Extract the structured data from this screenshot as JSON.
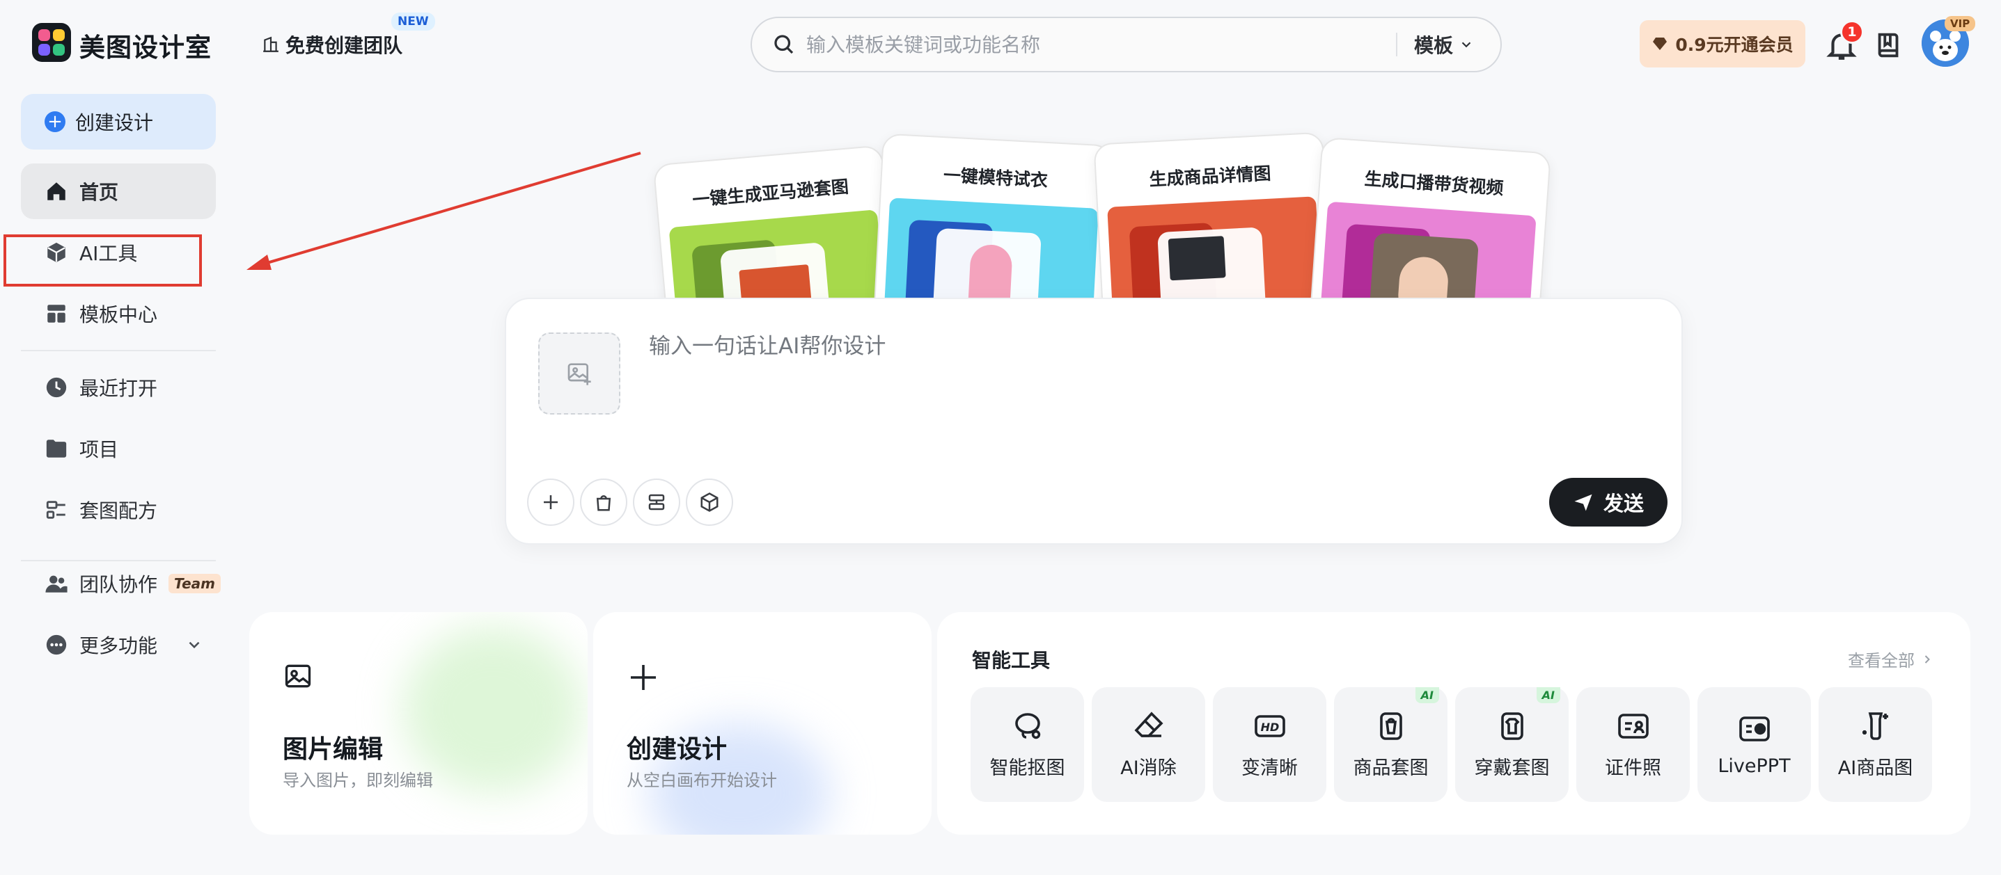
{
  "header": {
    "brand": "美图设计室",
    "team_link": "免费创建团队",
    "new_badge": "NEW",
    "search_placeholder": "输入模板关键词或功能名称",
    "search_type": "模板",
    "vip_button": "0.9元开通会员",
    "notification_count": "1",
    "avatar_badge": "VIP"
  },
  "sidebar": {
    "create": "创建设计",
    "items": [
      {
        "label": "首页",
        "icon": "home-icon",
        "active": true
      },
      {
        "label": "AI工具",
        "icon": "cube-icon",
        "active": false
      },
      {
        "label": "模板中心",
        "icon": "layout-icon",
        "active": false
      },
      {
        "label": "最近打开",
        "icon": "clock-icon",
        "active": false
      },
      {
        "label": "项目",
        "icon": "folder-icon",
        "active": false
      },
      {
        "label": "套图配方",
        "icon": "recipe-icon",
        "active": false
      },
      {
        "label": "团队协作",
        "icon": "team-icon",
        "active": false
      },
      {
        "label": "更多功能",
        "icon": "more-icon",
        "active": false
      }
    ],
    "team_tag": "Team"
  },
  "hero_cards": [
    {
      "title": "一键生成亚马逊套图",
      "color": "#a7d94b"
    },
    {
      "title": "一键模特试衣",
      "color": "#5ed6f0"
    },
    {
      "title": "生成商品详情图",
      "color": "#e5603e"
    },
    {
      "title": "生成口播带货视频",
      "color": "#e883d6"
    }
  ],
  "prompt": {
    "placeholder": "输入一句话让AI帮你设计",
    "send": "发送"
  },
  "quick_cards": [
    {
      "title": "图片编辑",
      "subtitle": "导入图片，即刻编辑"
    },
    {
      "title": "创建设计",
      "subtitle": "从空白画布开始设计"
    }
  ],
  "smart_tools": {
    "title": "智能工具",
    "see_all": "查看全部",
    "items": [
      {
        "label": "智能抠图",
        "icon": "lasso-icon",
        "ai": false
      },
      {
        "label": "AI消除",
        "icon": "eraser-icon",
        "ai": false
      },
      {
        "label": "变清晰",
        "icon": "hd-icon",
        "ai": false
      },
      {
        "label": "商品套图",
        "icon": "product-set-icon",
        "ai": true
      },
      {
        "label": "穿戴套图",
        "icon": "wear-set-icon",
        "ai": true
      },
      {
        "label": "证件照",
        "icon": "id-photo-icon",
        "ai": false
      },
      {
        "label": "LivePPT",
        "icon": "ppt-icon",
        "ai": false
      },
      {
        "label": "AI商品图",
        "icon": "ai-product-icon",
        "ai": false
      }
    ],
    "ai_badge": "AI"
  },
  "colors": {
    "accent": "#2f7bf1",
    "annotation_red": "#e03c31",
    "vip_bg": "#fde3cf"
  }
}
